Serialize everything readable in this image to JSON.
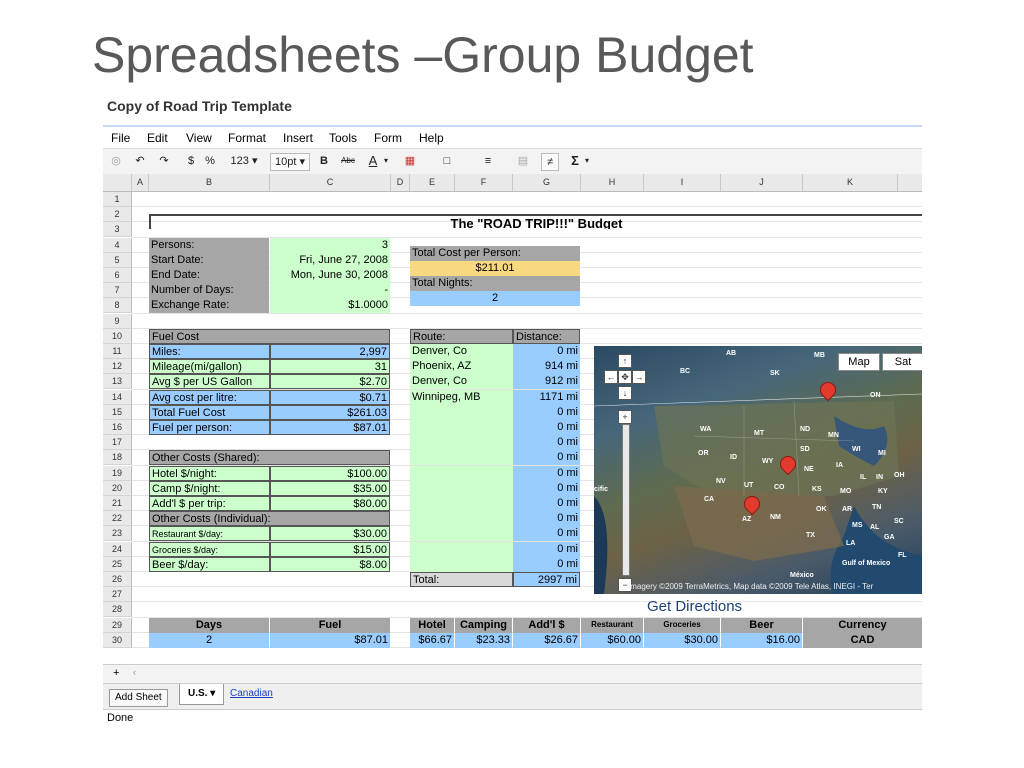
{
  "slide": {
    "title": "Spreadsheets –Group Budget"
  },
  "doc": {
    "title": "Copy of Road Trip Template"
  },
  "menu": [
    "File",
    "Edit",
    "View",
    "Format",
    "Insert",
    "Tools",
    "Form",
    "Help"
  ],
  "toolbar": {
    "currency": "$",
    "percent": "%",
    "number_format": "123 ▾",
    "font_size": "10pt ▾",
    "bold": "B",
    "strike": "Abc",
    "text_color": "A",
    "sum": "Σ"
  },
  "columns": [
    "A",
    "B",
    "C",
    "D",
    "E",
    "F",
    "G",
    "H",
    "I",
    "J",
    "K"
  ],
  "rows": [
    "1",
    "2",
    "3",
    "4",
    "5",
    "6",
    "7",
    "8",
    "9",
    "10",
    "11",
    "12",
    "13",
    "14",
    "15",
    "16",
    "17",
    "18",
    "19",
    "20",
    "21",
    "22",
    "23",
    "24",
    "25",
    "26",
    "27",
    "28",
    "29",
    "30"
  ],
  "budget_title": "The \"ROAD TRIP!!!\" Budget",
  "inputs": [
    {
      "label": "Persons:",
      "value": "3"
    },
    {
      "label": "Start Date:",
      "value": "Fri, June 27, 2008"
    },
    {
      "label": "End Date:",
      "value": "Mon, June 30, 2008"
    },
    {
      "label": "Number of Days:",
      "value": "-"
    },
    {
      "label": "Exchange Rate:",
      "value": "$1.0000"
    }
  ],
  "summary": {
    "cost_per_person_label": "Total Cost per Person:",
    "cost_per_person": "$211.01",
    "nights_label": "Total Nights:",
    "nights": "2"
  },
  "fuel": {
    "header": "Fuel Cost",
    "rows": [
      {
        "label": "Miles:",
        "value": "2,997"
      },
      {
        "label": "Mileage(mi/gallon)",
        "value": "31"
      },
      {
        "label": "Avg $ per US Gallon",
        "value": "$2.70"
      },
      {
        "label": "Avg cost per litre:",
        "value": "$0.71"
      },
      {
        "label": "Total Fuel Cost",
        "value": "$261.03"
      },
      {
        "label": "Fuel per person:",
        "value": "$87.01"
      }
    ]
  },
  "other_shared": {
    "header": "Other Costs (Shared):",
    "rows": [
      {
        "label": "Hotel $/night:",
        "value": "$100.00"
      },
      {
        "label": "Camp $/night:",
        "value": "$35.00"
      },
      {
        "label": "Add'l $ per trip:",
        "value": "$80.00"
      }
    ]
  },
  "other_individual": {
    "header": "Other Costs (Individual):",
    "rows": [
      {
        "label": "Restaurant $/day:",
        "value": "$30.00"
      },
      {
        "label": "Groceries $/day:",
        "value": "$15.00"
      },
      {
        "label": "Beer $/day:",
        "value": "$8.00"
      }
    ]
  },
  "route": {
    "route_label": "Route:",
    "distance_label": "Distance:",
    "stops": [
      {
        "place": "Denver, Co",
        "distance": "0 mi"
      },
      {
        "place": "Phoenix, AZ",
        "distance": "914 mi"
      },
      {
        "place": "Denver, Co",
        "distance": "912 mi"
      },
      {
        "place": "Winnipeg, MB",
        "distance": "1171 mi"
      },
      {
        "place": "",
        "distance": "0 mi"
      },
      {
        "place": "",
        "distance": "0 mi"
      },
      {
        "place": "",
        "distance": "0 mi"
      },
      {
        "place": "",
        "distance": "0 mi"
      },
      {
        "place": "",
        "distance": "0 mi"
      },
      {
        "place": "",
        "distance": "0 mi"
      },
      {
        "place": "",
        "distance": "0 mi"
      },
      {
        "place": "",
        "distance": "0 mi"
      },
      {
        "place": "",
        "distance": "0 mi"
      },
      {
        "place": "",
        "distance": "0 mi"
      },
      {
        "place": "",
        "distance": "0 mi"
      }
    ],
    "total_label": "Total:",
    "total": "2997 mi"
  },
  "map": {
    "tab_map": "Map",
    "tab_sat": "Sat",
    "attribution": "Imagery ©2009 TerraMetrics, Map data ©2009 Tele Atlas, INEGI - Ter",
    "labels": [
      "AB",
      "MB",
      "BC",
      "SK",
      "ON",
      "WA",
      "MT",
      "ND",
      "MN",
      "OR",
      "ID",
      "WY",
      "SD",
      "WI",
      "MI",
      "NE",
      "IA",
      "NV",
      "UT",
      "CO",
      "KS",
      "MO",
      "IL",
      "IN",
      "OH",
      "KY",
      "CA",
      "AZ",
      "NM",
      "OK",
      "AR",
      "TN",
      "TX",
      "MS",
      "AL",
      "SC",
      "GA",
      "LA",
      "FL",
      "México",
      "Gulf of Mexico",
      "cific"
    ],
    "get_directions": "Get Directions"
  },
  "totals": {
    "headers": [
      "Days",
      "Fuel",
      "Hotel",
      "Camping",
      "Add'l $",
      "Restaurant",
      "Groceries",
      "Beer",
      "Currency"
    ],
    "values": [
      "2",
      "$87.01",
      "$66.67",
      "$23.33",
      "$26.67",
      "$60.00",
      "$30.00",
      "$16.00",
      "CAD"
    ]
  },
  "sheets": {
    "add_sheet": "Add Sheet",
    "tabs": [
      "U.S. ▾",
      "Canadian"
    ]
  },
  "status": "Done",
  "colors": {
    "gray": "#a6a6a6",
    "green": "#ccffcc",
    "blue": "#99ccff",
    "yellow": "#f9d97f"
  }
}
